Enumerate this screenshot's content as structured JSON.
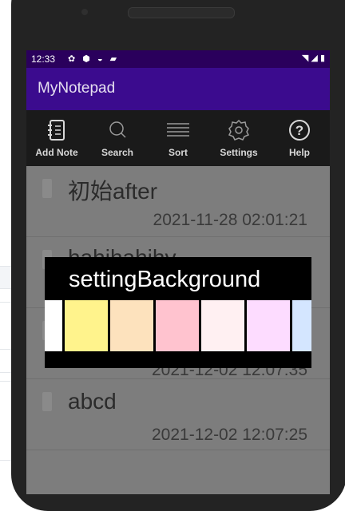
{
  "status_bar": {
    "time": "12:33",
    "left_icons": [
      "gear-icon",
      "shield-icon",
      "wifi-icon",
      "sdcard-icon"
    ],
    "right_icons": [
      "wifi-signal-icon",
      "cell-signal-icon",
      "battery-icon"
    ]
  },
  "app": {
    "title": "MyNotepad",
    "accent": "#3b0b8e",
    "status_color": "#2a005c"
  },
  "toolbar": {
    "items": [
      {
        "label": "Add Note",
        "icon": "notebook-icon"
      },
      {
        "label": "Search",
        "icon": "search-icon"
      },
      {
        "label": "Sort",
        "icon": "sort-icon"
      },
      {
        "label": "Settings",
        "icon": "gear-icon"
      },
      {
        "label": "Help",
        "icon": "help-icon"
      }
    ]
  },
  "notes": [
    {
      "title": "初始after",
      "time": "2021-11-28 02:01:21"
    },
    {
      "title": "hahihahihy",
      "time": ""
    },
    {
      "title": "",
      "time": "2021-12-02 12:07:35"
    },
    {
      "title": "abcd",
      "time": "2021-12-02 12:07:25"
    }
  ],
  "dialog": {
    "title": "settingBackground",
    "colors": [
      "#ffffff",
      "#fff38c",
      "#fde2bd",
      "#ffc3cf",
      "#fff0f2",
      "#fddcff",
      "#d4e6ff"
    ]
  }
}
